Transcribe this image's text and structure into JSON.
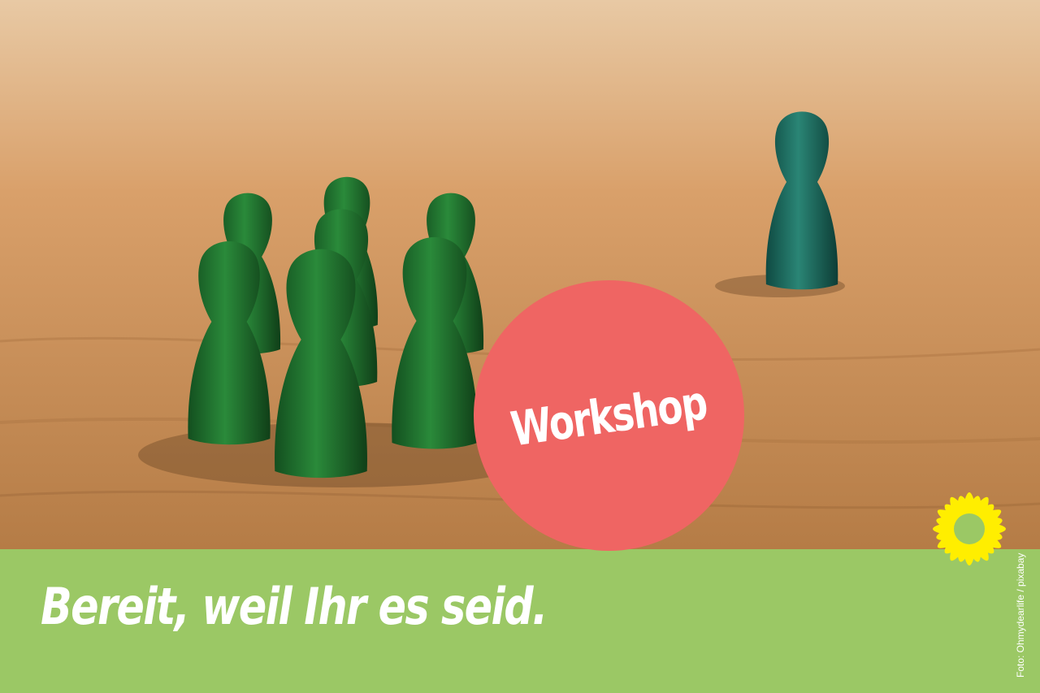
{
  "photo": {
    "icon": "game-pawns-photo",
    "colors": {
      "wood": "#c38c55",
      "pawn_group": "#1f6b2c",
      "pawn_single": "#1d6a5c"
    }
  },
  "badge": {
    "label": "Workshop",
    "color": "#ef6563"
  },
  "banner": {
    "slogan": "Bereit, weil Ihr es seid.",
    "color": "#9bc865"
  },
  "credit": "Foto: Ohmydearlife / pixabay",
  "logo": {
    "icon": "sunflower-logo-icon",
    "color": "#ffee00"
  }
}
